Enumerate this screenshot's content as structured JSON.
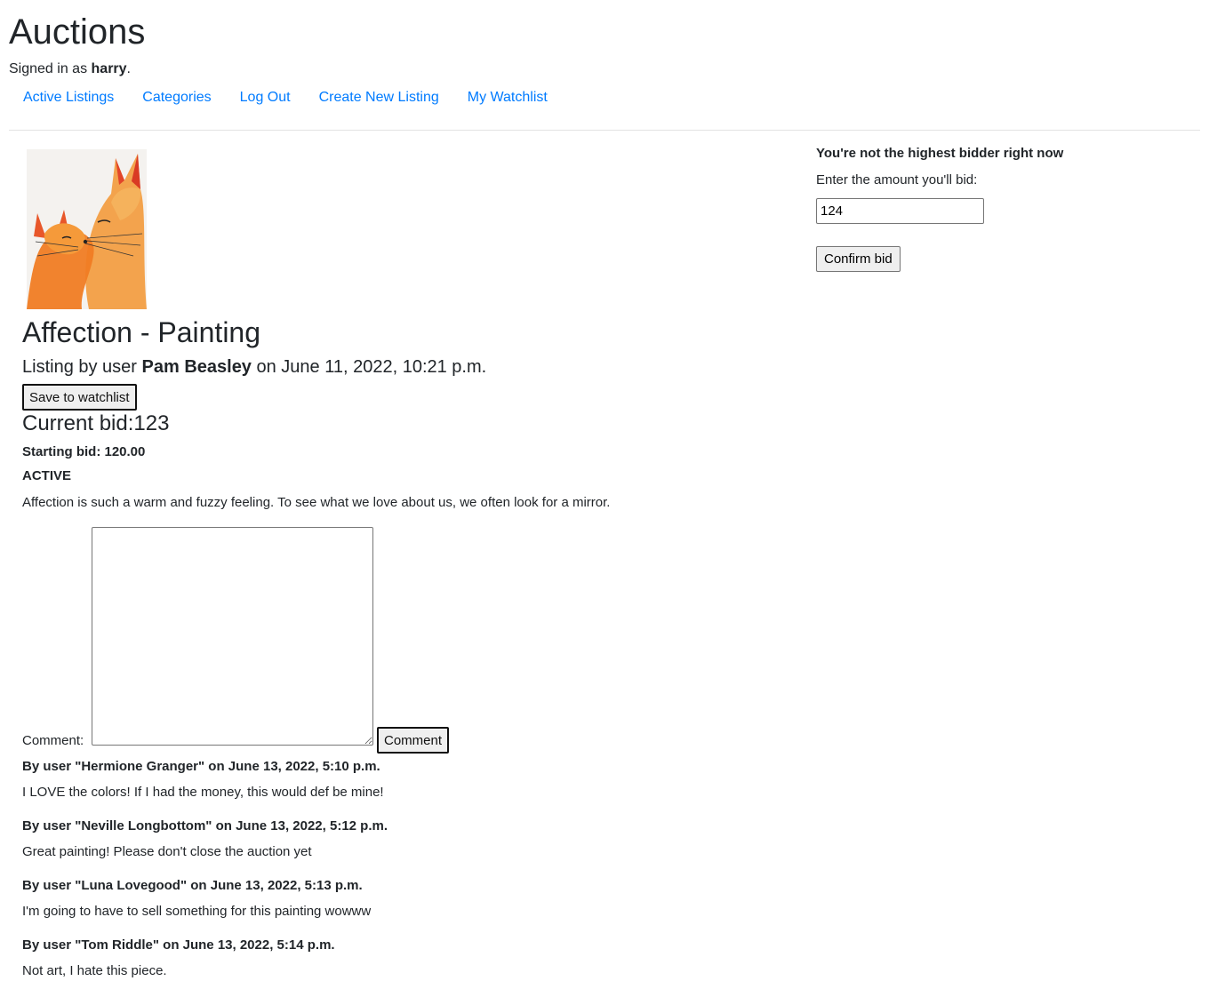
{
  "site": {
    "title": "Auctions",
    "signed_in_prefix": "Signed in as ",
    "username": "harry",
    "signed_in_suffix": "."
  },
  "nav": {
    "active_listings": "Active Listings",
    "categories": "Categories",
    "log_out": "Log Out",
    "create_listing": "Create New Listing",
    "watchlist": "My Watchlist"
  },
  "listing": {
    "image": "fox-painting-image",
    "title": "Affection - Painting",
    "by_prefix": "Listing by user ",
    "author": "Pam Beasley",
    "by_suffix": " on June 11, 2022, 10:21 p.m.",
    "watchlist_button": "Save to watchlist",
    "current_bid": "Current bid:123",
    "starting_bid": "Starting bid: 120.00",
    "status": "ACTIVE",
    "description": "Affection is such a warm and fuzzy feeling. To see what we love about us, we often look for a mirror."
  },
  "comment_form": {
    "label": "Comment:",
    "value": "",
    "button": "Comment"
  },
  "comments": [
    {
      "prefix": "By user ",
      "user": "\"Hermione Granger\"",
      "date": " on June 13, 2022, 5:10 p.m.",
      "text": "I LOVE the colors! If I had the money, this would def be mine!"
    },
    {
      "prefix": "By user ",
      "user": "\"Neville Longbottom\"",
      "date": " on June 13, 2022, 5:12 p.m.",
      "text": "Great painting! Please don't close the auction yet"
    },
    {
      "prefix": "By user ",
      "user": "\"Luna Lovegood\"",
      "date": " on June 13, 2022, 5:13 p.m.",
      "text": "I'm going to have to sell something for this painting wowww"
    },
    {
      "prefix": "By user ",
      "user": "\"Tom Riddle\"",
      "date": " on June 13, 2022, 5:14 p.m.",
      "text": "Not art, I hate this piece."
    }
  ],
  "bid": {
    "status": "You're not the highest bidder right now",
    "label": "Enter the amount you'll bid:",
    "value": "124",
    "button": "Confirm bid"
  }
}
